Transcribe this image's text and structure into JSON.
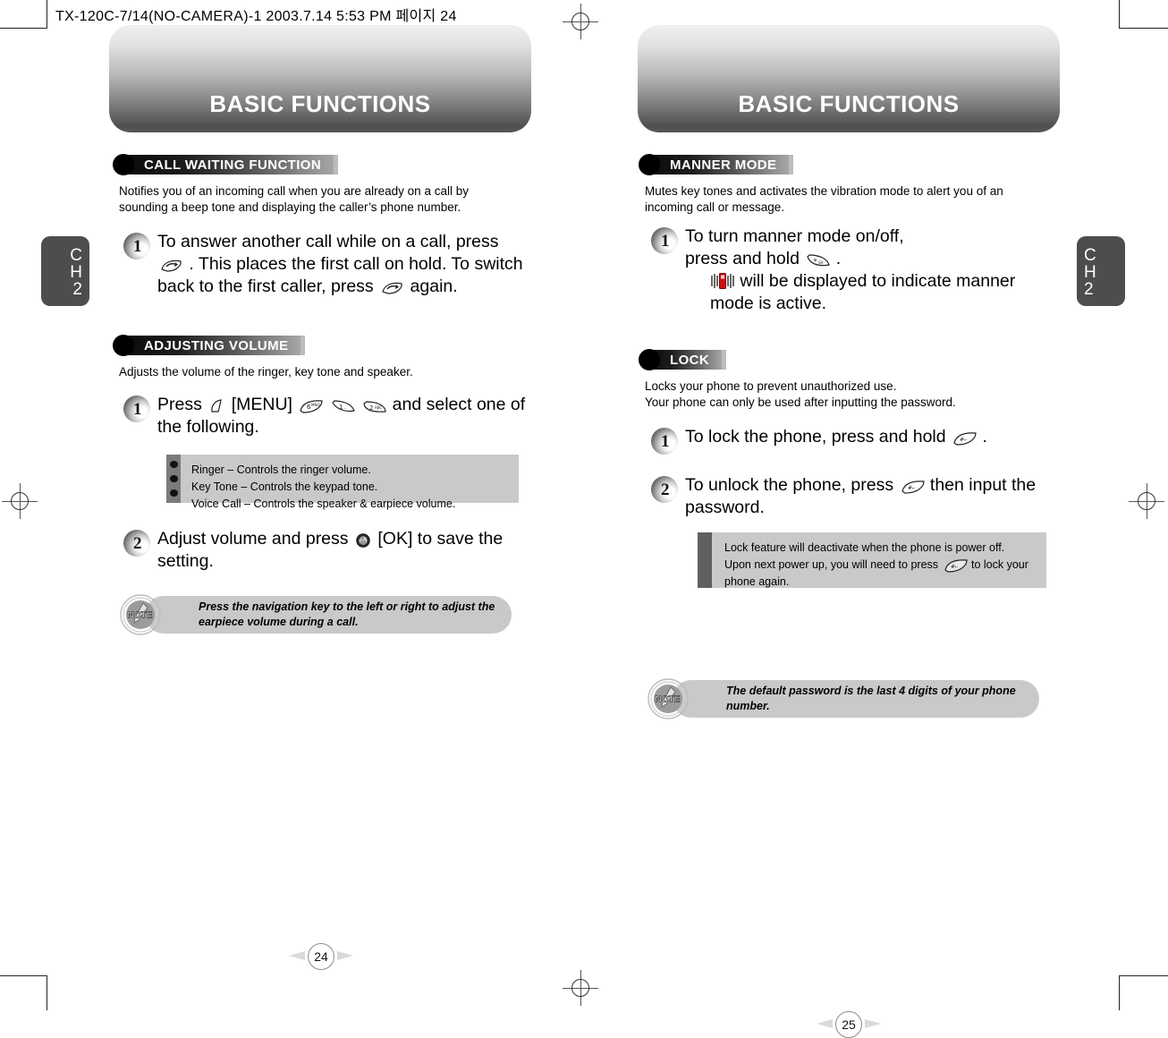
{
  "file_header": "TX-120C-7/14(NO-CAMERA)-1  2003.7.14 5:53 PM 페이지 24",
  "pages": {
    "left": {
      "banner_title": "BASIC FUNCTIONS",
      "chapter_tab": {
        "line1": "C",
        "line2": "H",
        "line3": "2"
      },
      "page_number": "24",
      "sections": [
        {
          "heading": "CALL WAITING FUNCTION",
          "intro": "Notifies you of an incoming call when you are already on a call by sounding a beep tone and displaying the caller’s phone number.",
          "steps": [
            {
              "number": "1",
              "text_a": "To answer another call while on a call, press",
              "icon_a": "send-key-icon",
              "text_b": ". This places the first call on hold. To switch back to the first caller, press",
              "icon_b": "send-key-icon",
              "text_c": "again."
            }
          ]
        },
        {
          "heading": "ADJUSTING VOLUME",
          "intro": "Adjusts the volume of the ringer, key tone and speaker.",
          "steps": [
            {
              "number": "1",
              "text_a": "Press",
              "icon_a": "softkey-icon",
              "text_b": "[MENU]",
              "keys": [
                "6 MNO",
                "1",
                "2 ABC"
              ],
              "text_c": "and select one of the following."
            },
            {
              "number": "2",
              "text_a": "Adjust volume and press",
              "icon_a": "ok-key-icon",
              "text_b": "[OK] to save the setting."
            }
          ],
          "bullets": [
            "Ringer – Controls the ringer volume.",
            "Key Tone – Controls the keypad tone.",
            "Voice Call – Controls the speaker & earpiece volume."
          ]
        }
      ],
      "note": "Press the navigation key to the left or right to adjust the earpiece volume during a call.",
      "note_badge_label": "NOTE"
    },
    "right": {
      "banner_title": "BASIC FUNCTIONS",
      "chapter_tab": {
        "line1": "C",
        "line2": "H",
        "line3": "2"
      },
      "page_number": "25",
      "sections": [
        {
          "heading": "MANNER MODE",
          "intro": "Mutes key tones and activates the vibration mode to alert you of an incoming call or message.",
          "steps": [
            {
              "number": "1",
              "text_a": "To turn manner mode on/off,",
              "text_b": "press and hold",
              "icon_a": "star-key-icon",
              "text_c": ".",
              "icon_b": "vibrate-icon",
              "text_d": "will be displayed to indicate manner mode is active."
            }
          ]
        },
        {
          "heading": "LOCK",
          "intro_line1": "Locks your phone to prevent unauthorized use.",
          "intro_line2": "Your phone can only be used after inputting the password.",
          "steps": [
            {
              "number": "1",
              "text_a": "To lock the phone, press and hold",
              "icon_a": "pound-key-icon",
              "text_b": "."
            },
            {
              "number": "2",
              "text_a": "To unlock the phone, press",
              "icon_a": "pound-key-icon",
              "text_b": "then input the password."
            }
          ],
          "panel_text_a": "Lock feature will deactivate when the phone is power off. Upon next power up, you will need to press",
          "panel_icon": "pound-key-icon",
          "panel_text_b": "to lock your phone again."
        }
      ],
      "note": "The default password is the last 4 digits of your phone number.",
      "note_badge_label": "NOTE"
    }
  },
  "colors": {
    "banner_top": "#efefef",
    "banner_bottom": "#4f4f4f",
    "panel_gray": "#c9c9c9",
    "rail_dark": "#5f5f5f",
    "tab_gray": "#4d4d4d",
    "vibrate_red": "#cc1111"
  }
}
